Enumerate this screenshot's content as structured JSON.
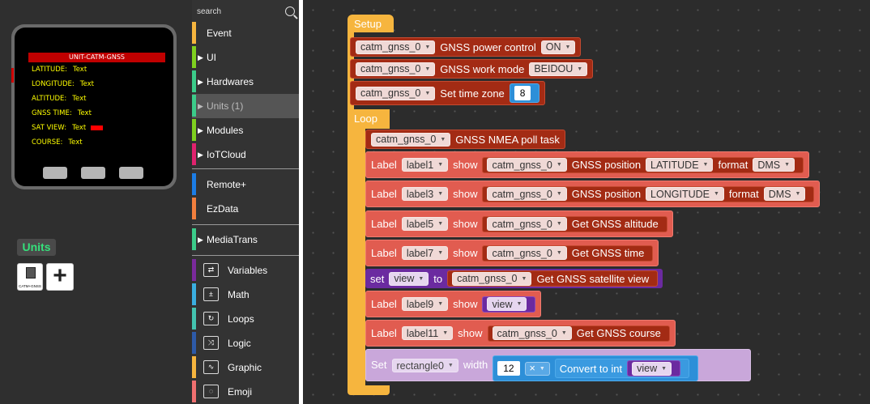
{
  "device": {
    "screen_title": "UNIT-CATM-GNSS",
    "rows": [
      {
        "label": "LATITUDE:",
        "value": "Text"
      },
      {
        "label": "LONGITUDE:",
        "value": "Text"
      },
      {
        "label": "ALTITUDE:",
        "value": "Text"
      },
      {
        "label": "GNSS TIME:",
        "value": "Text"
      },
      {
        "label": "SAT VIEW:",
        "value": "Text"
      },
      {
        "label": "COURSE:",
        "value": "Text"
      }
    ]
  },
  "units_panel": {
    "title": "Units",
    "unit_tile_label": "CATM+GNSS",
    "add_label": "+"
  },
  "toolbox": {
    "search_placeholder": "search",
    "categories": [
      {
        "label": "Event",
        "color": "#f6b53e"
      },
      {
        "label": "UI",
        "color": "#7fd11f"
      },
      {
        "label": "Hardwares",
        "color": "#3bcc8a"
      },
      {
        "label": "Units (1)",
        "color": "#3bcc8a"
      },
      {
        "label": "Modules",
        "color": "#7fd11f"
      },
      {
        "label": "IoTCloud",
        "color": "#e0226e"
      },
      {
        "label": "Remote+",
        "color": "#1c7de5"
      },
      {
        "label": "EzData",
        "color": "#f27f3d"
      },
      {
        "label": "MediaTrans",
        "color": "#3bcc8a"
      },
      {
        "label": "Variables",
        "color": "#7a2a9c"
      },
      {
        "label": "Math",
        "color": "#3aaee0"
      },
      {
        "label": "Loops",
        "color": "#43c4b0"
      },
      {
        "label": "Logic",
        "color": "#2d5aa8"
      },
      {
        "label": "Graphic",
        "color": "#f6b53e"
      },
      {
        "label": "Emoji",
        "color": "#f07070"
      }
    ]
  },
  "workspace": {
    "setup_label": "Setup",
    "loop_label": "Loop",
    "setup_blocks": [
      {
        "dropdown": "catm_gnss_0",
        "text": "GNSS power control",
        "option": "ON"
      },
      {
        "dropdown": "catm_gnss_0",
        "text": "GNSS work mode",
        "option": "BEIDOU"
      },
      {
        "dropdown": "catm_gnss_0",
        "text": "Set time zone",
        "number": "8"
      }
    ],
    "loop_blocks": {
      "poll": {
        "dropdown": "catm_gnss_0",
        "text": "GNSS NMEA poll task"
      },
      "label1": {
        "label_word": "Label",
        "label": "label1",
        "show": "show",
        "dropdown": "catm_gnss_0",
        "text": "GNSS position",
        "option": "LATITUDE",
        "format_word": "format",
        "format": "DMS"
      },
      "label3": {
        "label_word": "Label",
        "label": "label3",
        "show": "show",
        "dropdown": "catm_gnss_0",
        "text": "GNSS position",
        "option": "LONGITUDE",
        "format_word": "format",
        "format": "DMS"
      },
      "label5": {
        "label_word": "Label",
        "label": "label5",
        "show": "show",
        "dropdown": "catm_gnss_0",
        "text": "Get GNSS altitude"
      },
      "label7": {
        "label_word": "Label",
        "label": "label7",
        "show": "show",
        "dropdown": "catm_gnss_0",
        "text": "Get GNSS time"
      },
      "setview": {
        "set_word": "set",
        "var": "view",
        "to_word": "to",
        "dropdown": "catm_gnss_0",
        "text": "Get GNSS satellite view"
      },
      "label9": {
        "label_word": "Label",
        "label": "label9",
        "show": "show",
        "var": "view"
      },
      "label11": {
        "label_word": "Label",
        "label": "label11",
        "show": "show",
        "dropdown": "catm_gnss_0",
        "text": "Get GNSS course"
      },
      "rect": {
        "set_word": "Set",
        "rect": "rectangle0",
        "width_word": "width",
        "number": "12",
        "op": "×",
        "convert": "Convert to int",
        "var": "view"
      }
    }
  }
}
